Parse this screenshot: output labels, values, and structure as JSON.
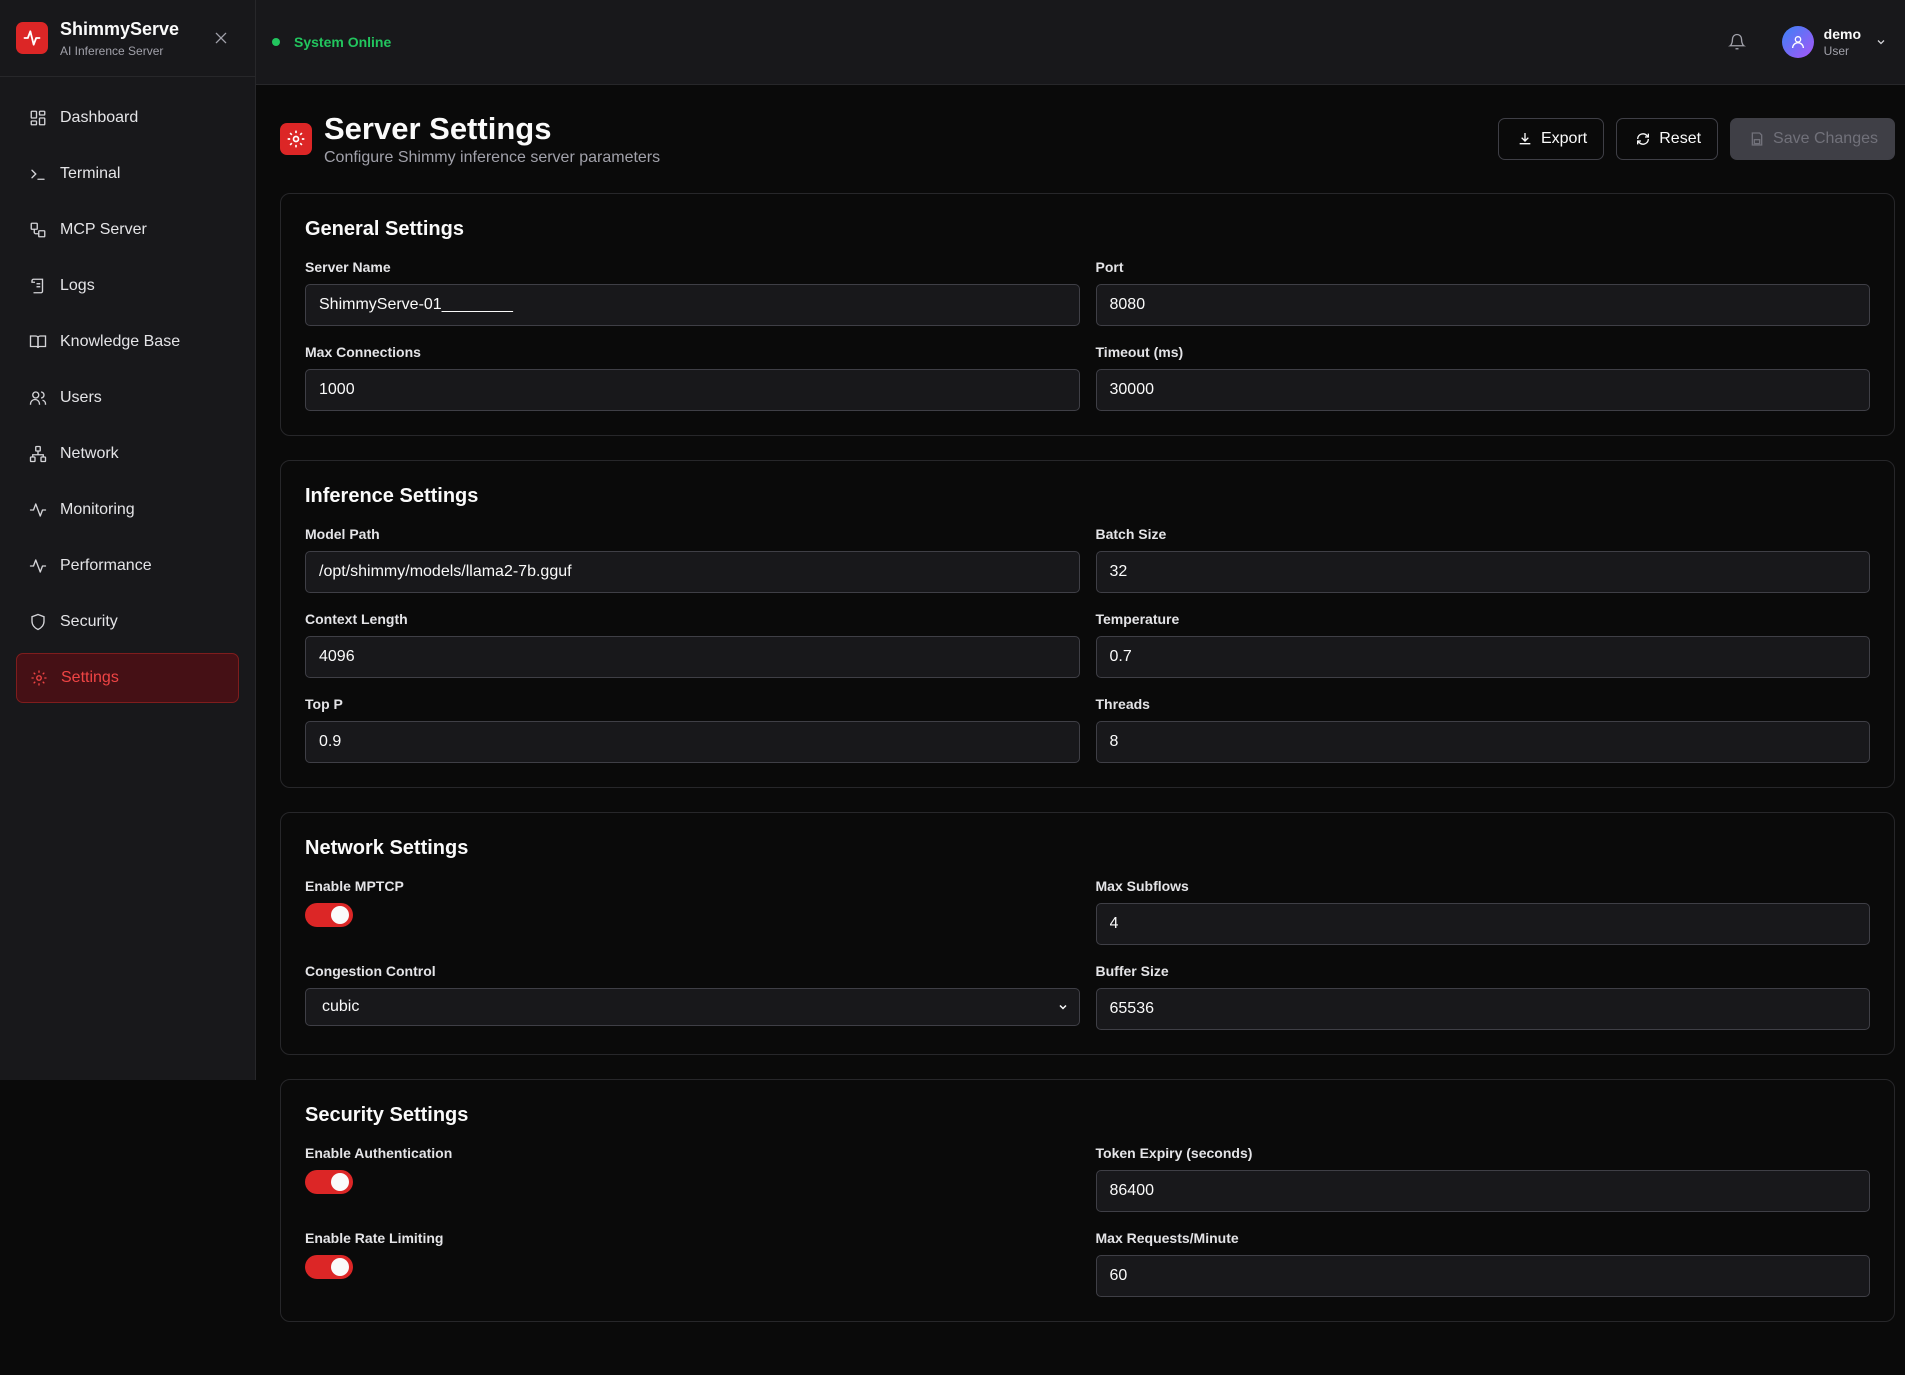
{
  "app": {
    "name": "ShimmyServe",
    "subtitle": "AI Inference Server"
  },
  "status": {
    "text": "System Online",
    "color": "#22c55e"
  },
  "user": {
    "name": "demo",
    "role": "User"
  },
  "sidebar": {
    "items": [
      {
        "label": "Dashboard",
        "icon": "dashboard-icon"
      },
      {
        "label": "Terminal",
        "icon": "terminal-icon"
      },
      {
        "label": "MCP Server",
        "icon": "mcp-server-icon"
      },
      {
        "label": "Logs",
        "icon": "logs-icon"
      },
      {
        "label": "Knowledge Base",
        "icon": "book-icon"
      },
      {
        "label": "Users",
        "icon": "users-icon"
      },
      {
        "label": "Network",
        "icon": "network-icon"
      },
      {
        "label": "Monitoring",
        "icon": "activity-icon"
      },
      {
        "label": "Performance",
        "icon": "activity-icon"
      },
      {
        "label": "Security",
        "icon": "shield-icon"
      },
      {
        "label": "Settings",
        "icon": "gear-icon",
        "active": true
      }
    ]
  },
  "page": {
    "title": "Server Settings",
    "subtitle": "Configure Shimmy inference server parameters"
  },
  "actions": {
    "export": "Export",
    "reset": "Reset",
    "save": "Save Changes"
  },
  "general": {
    "title": "General Settings",
    "server_name": {
      "label": "Server Name",
      "value": "ShimmyServe-01________"
    },
    "port": {
      "label": "Port",
      "value": "8080"
    },
    "max_connections": {
      "label": "Max Connections",
      "value": "1000"
    },
    "timeout": {
      "label": "Timeout (ms)",
      "value": "30000"
    }
  },
  "inference": {
    "title": "Inference Settings",
    "model_path": {
      "label": "Model Path",
      "value": "/opt/shimmy/models/llama2-7b.gguf"
    },
    "batch_size": {
      "label": "Batch Size",
      "value": "32"
    },
    "context_length": {
      "label": "Context Length",
      "value": "4096"
    },
    "temperature": {
      "label": "Temperature",
      "value": "0.7"
    },
    "top_p": {
      "label": "Top P",
      "value": "0.9"
    },
    "threads": {
      "label": "Threads",
      "value": "8"
    }
  },
  "network": {
    "title": "Network Settings",
    "enable_mptcp": {
      "label": "Enable MPTCP",
      "enabled": true
    },
    "max_subflows": {
      "label": "Max Subflows",
      "value": "4"
    },
    "congestion_control": {
      "label": "Congestion Control",
      "value": "cubic"
    },
    "buffer_size": {
      "label": "Buffer Size",
      "value": "65536"
    }
  },
  "security": {
    "title": "Security Settings",
    "enable_auth": {
      "label": "Enable Authentication",
      "enabled": true
    },
    "token_expiry": {
      "label": "Token Expiry (seconds)",
      "value": "86400"
    },
    "enable_rate_limiting": {
      "label": "Enable Rate Limiting",
      "enabled": true
    },
    "max_requests": {
      "label": "Max Requests/Minute",
      "value": "60"
    }
  },
  "colors": {
    "accent": "#dc2626",
    "background": "#0a0a0a",
    "panel": "#18181b",
    "border": "#27272a"
  }
}
